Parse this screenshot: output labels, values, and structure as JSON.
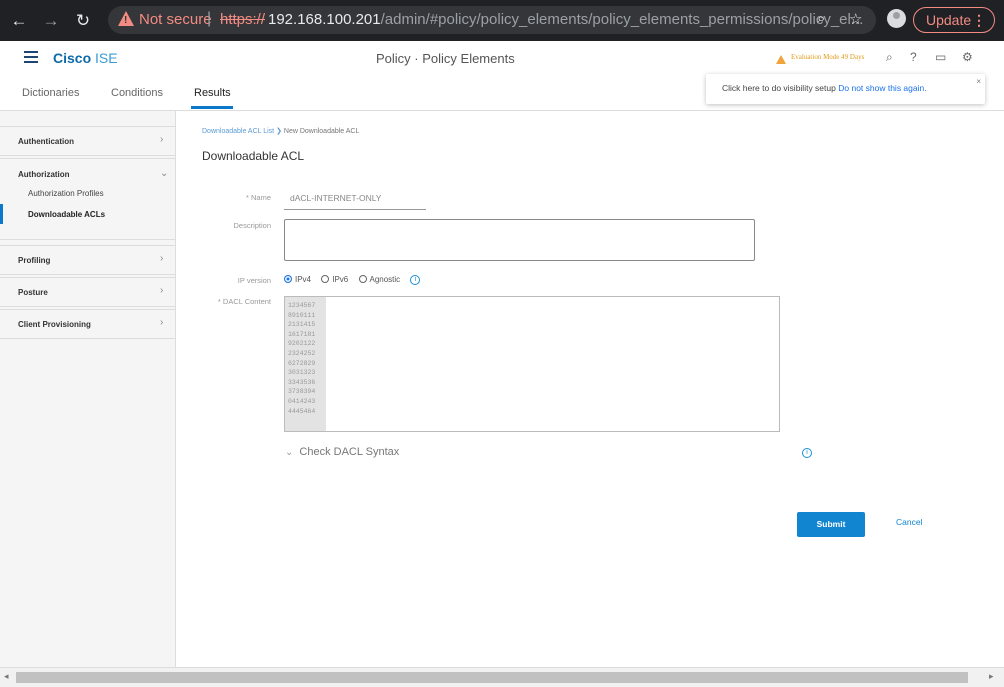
{
  "browser": {
    "security_warning": "Not secure",
    "url_scheme": "https://",
    "url_host": "192.168.100.201",
    "url_path": "/admin/#policy/policy_elements/policy_elements_permissions/policy_el...",
    "update_label": "Update"
  },
  "app": {
    "brand_bold": "Cisco",
    "brand_light": "ISE",
    "page_heading": "Policy · Policy Elements",
    "evaluation_notice": "Evaluation Mode 49 Days"
  },
  "tabs": [
    {
      "label": "Dictionaries",
      "active": false
    },
    {
      "label": "Conditions",
      "active": false
    },
    {
      "label": "Results",
      "active": true
    }
  ],
  "popover": {
    "text": "Click here to do visibility setup",
    "link": "Do not show this again.",
    "close": "×"
  },
  "sidebar": {
    "authentication": "Authentication",
    "authorization": "Authorization",
    "authorization_profiles": "Authorization Profiles",
    "downloadable_acls": "Downloadable ACLs",
    "profiling": "Profiling",
    "posture": "Posture",
    "client_provisioning": "Client Provisioning"
  },
  "breadcrumb": {
    "parent": "Downloadable ACL List",
    "current": "New Downloadable ACL"
  },
  "form": {
    "title": "Downloadable ACL",
    "name_label": "* Name",
    "name_value": "dACL-INTERNET-ONLY",
    "description_label": "Description",
    "description_value": "",
    "ip_version_label": "IP version",
    "ip_options": [
      "IPv4",
      "IPv6",
      "Agnostic"
    ],
    "ip_selected": "IPv4",
    "dacl_label": "* DACL Content",
    "line_numbers": [
      "1234567",
      "8910111",
      "2131415",
      "1617181",
      "9202122",
      "2324252",
      "6272829",
      "3031323",
      "3343536",
      "3738394",
      "0414243",
      "4445464"
    ],
    "check_syntax": "Check DACL Syntax",
    "submit": "Submit",
    "cancel": "Cancel"
  },
  "colors": {
    "accent": "#1285d1",
    "warning": "#f28b82",
    "evaluation": "#f2a33a"
  }
}
